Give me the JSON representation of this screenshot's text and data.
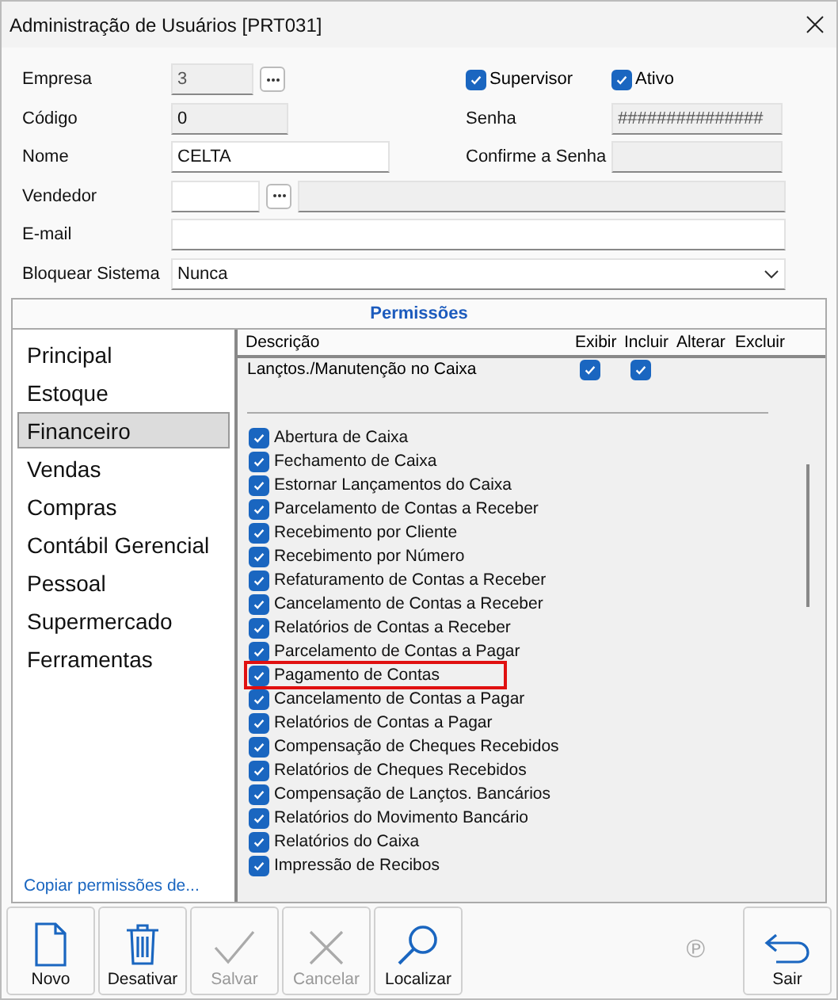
{
  "window": {
    "title": "Administração de Usuários [PRT031]"
  },
  "form": {
    "empresa": {
      "label": "Empresa",
      "value": "3"
    },
    "supervisor": {
      "label": "Supervisor",
      "checked": true
    },
    "ativo": {
      "label": "Ativo",
      "checked": true
    },
    "codigo": {
      "label": "Código",
      "value": "0"
    },
    "senha": {
      "label": "Senha",
      "value": "###############"
    },
    "nome": {
      "label": "Nome",
      "value": "CELTA"
    },
    "confirme": {
      "label": "Confirme a Senha"
    },
    "vendedor": {
      "label": "Vendedor"
    },
    "email": {
      "label": "E-mail"
    },
    "bloquear": {
      "label": "Bloquear Sistema",
      "value": "Nunca"
    }
  },
  "permissions": {
    "title": "Permissões",
    "categories": [
      {
        "label": "Principal",
        "selected": false
      },
      {
        "label": "Estoque",
        "selected": false
      },
      {
        "label": "Financeiro",
        "selected": true
      },
      {
        "label": "Vendas",
        "selected": false
      },
      {
        "label": "Compras",
        "selected": false
      },
      {
        "label": "Contábil Gerencial",
        "selected": false
      },
      {
        "label": "Pessoal",
        "selected": false
      },
      {
        "label": "Supermercado",
        "selected": false
      },
      {
        "label": "Ferramentas",
        "selected": false
      }
    ],
    "copy_link": "Copiar permissões de...",
    "columns": [
      "Descrição",
      "Exibir",
      "Incluir",
      "Alterar",
      "Excluir"
    ],
    "rows": [
      {
        "kind": "grouped",
        "label": "Lançtos./Manutenção no Caixa",
        "exibir": true,
        "incluir": true
      },
      {
        "kind": "check",
        "label": "Abertura de Caixa",
        "checked": true,
        "highlighted": false
      },
      {
        "kind": "check",
        "label": "Fechamento de Caixa",
        "checked": true,
        "highlighted": false
      },
      {
        "kind": "check",
        "label": "Estornar Lançamentos do Caixa",
        "checked": true,
        "highlighted": false
      },
      {
        "kind": "check",
        "label": "Parcelamento de Contas a Receber",
        "checked": true,
        "highlighted": false
      },
      {
        "kind": "check",
        "label": "Recebimento por Cliente",
        "checked": true,
        "highlighted": false
      },
      {
        "kind": "check",
        "label": "Recebimento por Número",
        "checked": true,
        "highlighted": false
      },
      {
        "kind": "check",
        "label": "Refaturamento de Contas a Receber",
        "checked": true,
        "highlighted": false
      },
      {
        "kind": "check",
        "label": "Cancelamento de Contas a Receber",
        "checked": true,
        "highlighted": false
      },
      {
        "kind": "check",
        "label": "Relatórios de Contas a Receber",
        "checked": true,
        "highlighted": false
      },
      {
        "kind": "check",
        "label": "Parcelamento de Contas a Pagar",
        "checked": true,
        "highlighted": false
      },
      {
        "kind": "check",
        "label": "Pagamento de Contas",
        "checked": true,
        "highlighted": true
      },
      {
        "kind": "check",
        "label": "Cancelamento de Contas a Pagar",
        "checked": true,
        "highlighted": false
      },
      {
        "kind": "check",
        "label": "Relatórios de Contas a Pagar",
        "checked": true,
        "highlighted": false
      },
      {
        "kind": "check",
        "label": "Compensação de Cheques Recebidos",
        "checked": true,
        "highlighted": false
      },
      {
        "kind": "check",
        "label": "Relatórios de Cheques Recebidos",
        "checked": true,
        "highlighted": false
      },
      {
        "kind": "check",
        "label": "Compensação de Lançtos. Bancários",
        "checked": true,
        "highlighted": false
      },
      {
        "kind": "check",
        "label": "Relatórios do Movimento Bancário",
        "checked": true,
        "highlighted": false
      },
      {
        "kind": "check",
        "label": "Relatórios do Caixa",
        "checked": true,
        "highlighted": false
      },
      {
        "kind": "check",
        "label": "Impressão de Recibos",
        "checked": true,
        "highlighted": false
      }
    ]
  },
  "toolbar": {
    "buttons": [
      {
        "label": "Novo",
        "disabled": false
      },
      {
        "label": "Desativar",
        "disabled": false
      },
      {
        "label": "Salvar",
        "disabled": true
      },
      {
        "label": "Cancelar",
        "disabled": true
      },
      {
        "label": "Localizar",
        "disabled": false
      }
    ],
    "mark": "℗",
    "exit": {
      "label": "Sair",
      "disabled": false
    }
  }
}
